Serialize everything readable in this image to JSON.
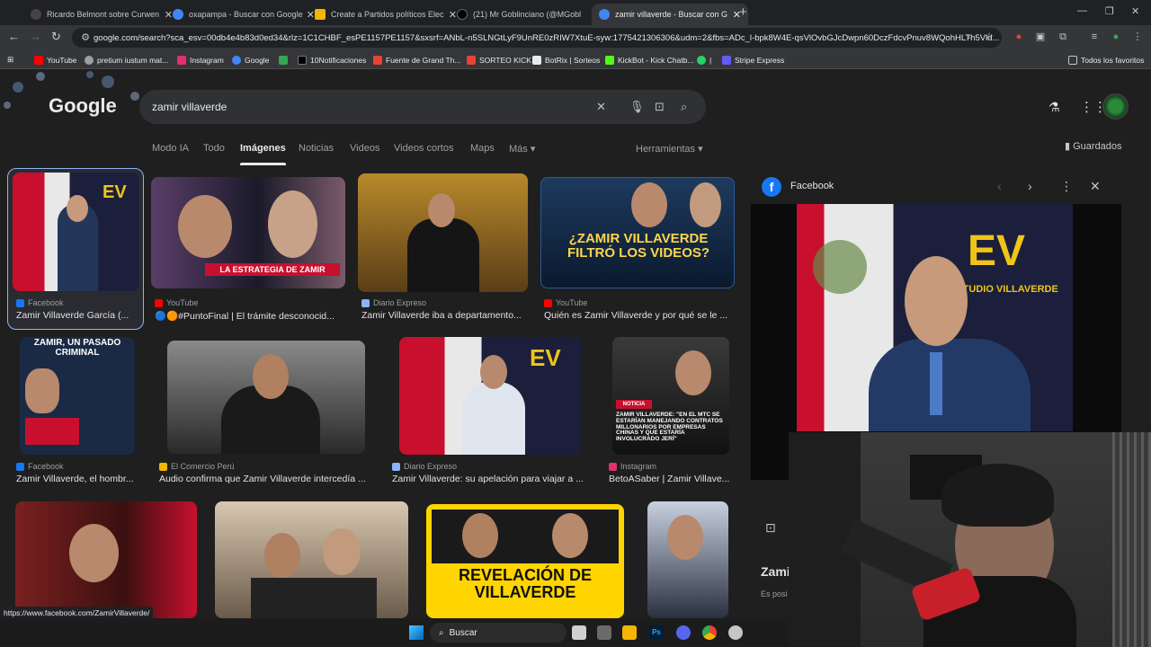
{
  "tabs": [
    {
      "title": "Ricardo Belmont sobre Curwen",
      "color": "#e8eaed"
    },
    {
      "title": "oxapampa - Buscar con Google",
      "color": "#4285f4"
    },
    {
      "title": "Create a Partidos políticos Elec",
      "color": "#f4b400"
    },
    {
      "title": "(21) Mr Goblinciano (@MGobl",
      "color": "#e8eaed"
    },
    {
      "title": "zamir villaverde - Buscar con G",
      "color": "#4285f4"
    }
  ],
  "url": "google.com/search?sca_esv=00db4e4b83d0ed34&rlz=1C1CHBF_esPE1157PE1157&sxsrf=ANbL-n5SLNGtLyF9UnRE0zRIW7XtuE-syw:1775421306306&udm=2&fbs=ADc_l-bpk8W4E-qsVlOvbGJcDwpn60DczFdcvPnuv8WQohHLTh5Vld...",
  "bookmarks": [
    {
      "label": "YouTube",
      "color": "#ff0000"
    },
    {
      "label": "pretium iustum mat...",
      "color": "#e8eaed"
    },
    {
      "label": "Instagram",
      "color": "#e1306c"
    },
    {
      "label": "Google",
      "color": "#4285f4"
    },
    {
      "label": "",
      "color": "#34a853"
    },
    {
      "label": "10Notificaciones",
      "color": "#e8eaed"
    },
    {
      "label": "Fuente de Grand Th...",
      "color": "#ea4335"
    },
    {
      "label": "SORTEO KICK",
      "color": "#e8eaed"
    },
    {
      "label": "BotRix | Sorteos",
      "color": "#e8eaed"
    },
    {
      "label": "KickBot - Kick Chatb...",
      "color": "#53fc18"
    },
    {
      "label": "|",
      "color": "#25d366"
    },
    {
      "label": "Stripe Express",
      "color": "#635bff"
    }
  ],
  "bookmarks_other": "Todos los favoritos",
  "search": {
    "query": "zamir villaverde",
    "logo": "Google"
  },
  "nav": {
    "tabs": [
      "Modo IA",
      "Todo",
      "Imágenes",
      "Noticias",
      "Videos",
      "Videos cortos",
      "Maps",
      "Más ▾"
    ],
    "active": "Imágenes",
    "tools": "Herramientas ▾",
    "saved": "Guardados"
  },
  "results": [
    {
      "source": "Facebook",
      "caption": "Zamir Villaverde García (...",
      "src_color": "#1877f2"
    },
    {
      "source": "YouTube",
      "caption": "🔵🟠#PuntoFinal | El trámite desconocid...",
      "src_color": "#ff0000",
      "overlay": "LA ESTRATEGIA DE ZAMIR"
    },
    {
      "source": "Diario Expreso",
      "caption": "Zamir Villaverde iba a departamento...",
      "src_color": "#8ab4f8"
    },
    {
      "source": "YouTube",
      "caption": "Quién es Zamir Villaverde y por qué se le ...",
      "src_color": "#ff0000",
      "overlay": "¿ZAMIR VILLAVERDE FILTRÓ LOS VIDEOS?"
    },
    {
      "source": "Facebook",
      "caption": "Zamir Villaverde, el hombr...",
      "src_color": "#1877f2",
      "overlay": "ZAMIR, UN PASADO CRIMINAL"
    },
    {
      "source": "El Comercio Perú",
      "caption": "Audio confirma que Zamir Villaverde intercedía ...",
      "src_color": "#f4b400"
    },
    {
      "source": "Diario Expreso",
      "caption": "Zamir Villaverde: su apelación para viajar a ...",
      "src_color": "#8ab4f8"
    },
    {
      "source": "Instagram",
      "caption": "BetoASaber | Zamir Villave...",
      "src_color": "#e1306c",
      "overlay": "ZAMIR VILLAVERDE: \"EN EL MTC SE ESTARÍAN MANEJANDO CONTRATOS MILLONARIOS POR EMPRESAS CHINAS Y QUE ESTARÍA INVOLUCRADO JERÍ\""
    },
    {
      "overlay": "REVELACIÓN DE VILLAVERDE"
    }
  ],
  "panel": {
    "source": "Facebook",
    "title_partial": "Zami",
    "subtitle_partial": "Es posi",
    "logo_text": "EV",
    "logo_sub": "ESTUDIO VILLAVERDE"
  },
  "status_url": "https://www.facebook.com/ZamirVillaverde/",
  "taskbar": {
    "search": "Buscar"
  }
}
